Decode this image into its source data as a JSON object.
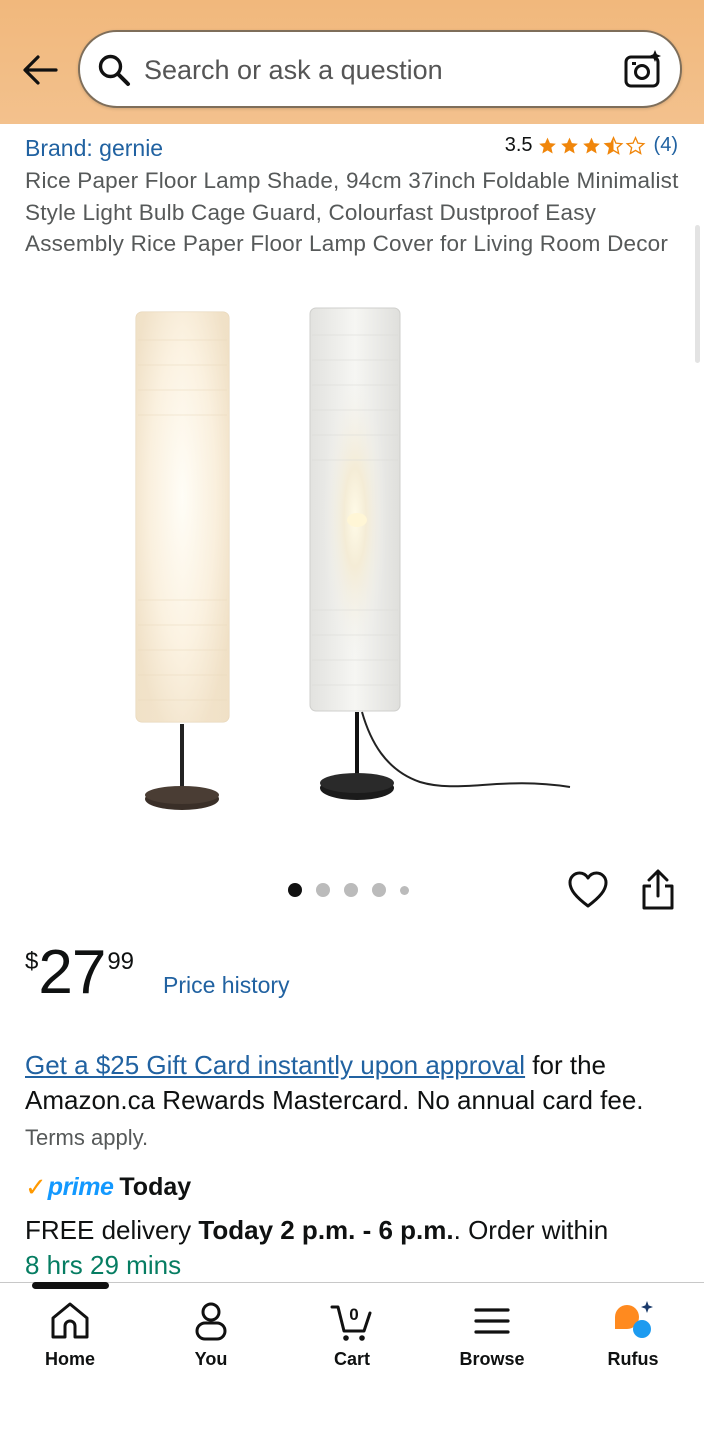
{
  "header": {
    "search_placeholder": "Search or ask a question",
    "icons": {
      "back": "back-arrow-icon",
      "search": "search-icon",
      "camera": "camera-lens-icon"
    }
  },
  "product": {
    "brand": "Brand: gernie",
    "rating_value": "3.5",
    "rating_stars": 3.5,
    "rating_count": "(4)",
    "title": "Rice Paper Floor Lamp Shade, 94cm 37inch Foldable Minimalist Style Light Bulb Cage Guard, Colourfast Dustproof Easy Assembly Rice Paper Floor Lamp Cover for Living Room Decor",
    "image_count": 5,
    "active_image": 0
  },
  "price": {
    "symbol": "$",
    "whole": "27",
    "fraction": "99",
    "history_link": "Price history"
  },
  "offer": {
    "link_text": "Get a $25 Gift Card instantly upon approval",
    "body_text": " for the Amazon.ca Rewards Mastercard. No annual card fee.",
    "terms_text": " Terms apply."
  },
  "delivery": {
    "prime_check": "✓",
    "prime_label": "prime",
    "prime_today": "Today",
    "prefix": "FREE delivery ",
    "window": "Today 2 p.m. - 6 p.m.",
    "middle": ". Order within",
    "countdown": "8 hrs 29 mins"
  },
  "nav": {
    "items": [
      {
        "label": "Home",
        "icon": "home-icon"
      },
      {
        "label": "You",
        "icon": "person-icon"
      },
      {
        "label": "Cart",
        "icon": "cart-icon",
        "badge": "0"
      },
      {
        "label": "Browse",
        "icon": "menu-icon"
      },
      {
        "label": "Rufus",
        "icon": "rufus-icon"
      }
    ],
    "active": 0
  },
  "colors": {
    "link": "#2162a1",
    "header": "#f1b87c",
    "star": "#f0860b",
    "countdown": "#067d62",
    "prime_blue": "#1399ff",
    "prime_orange": "#ff9900"
  }
}
